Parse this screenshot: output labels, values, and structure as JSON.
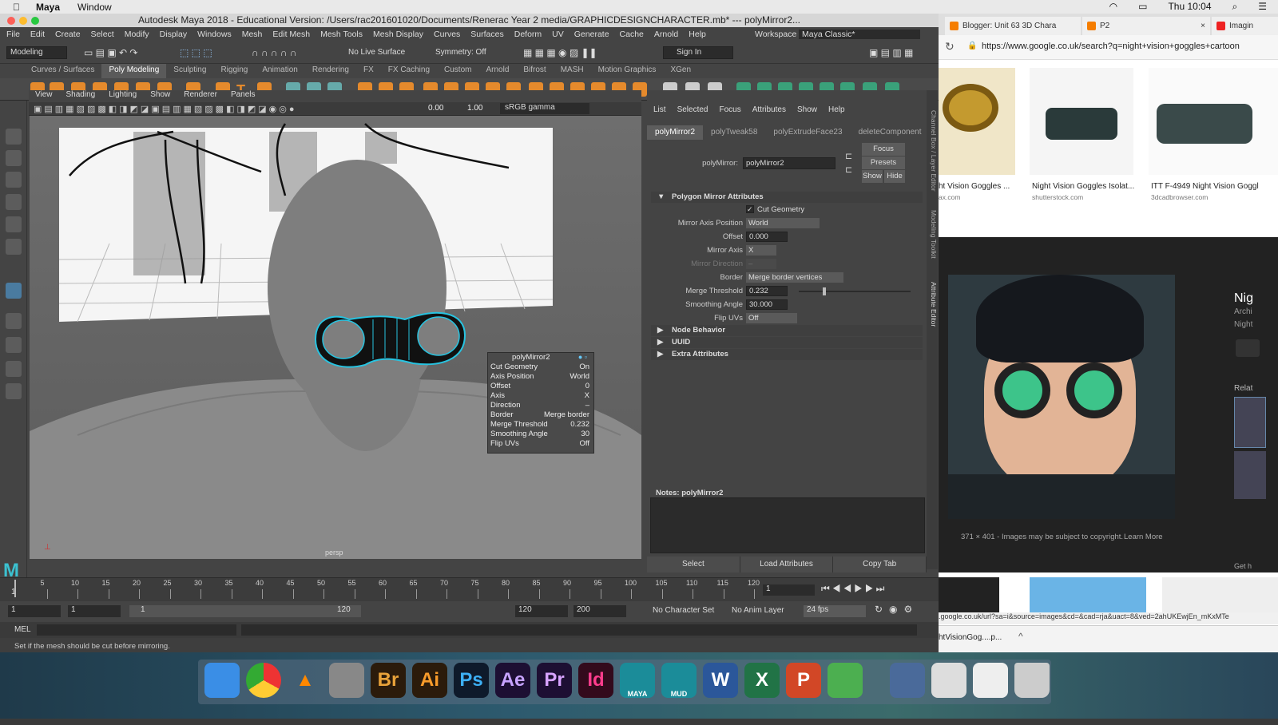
{
  "macos": {
    "app": "Maya",
    "menu": [
      "Window"
    ],
    "clock": "Thu 10:04"
  },
  "maya": {
    "title": "Autodesk Maya 2018 - Educational Version: /Users/rac201601020/Documents/Renerac Year 2 media/GRAPHICDESIGNCHARACTER.mb*  ---  polyMirror2...",
    "menu": [
      "File",
      "Edit",
      "Create",
      "Select",
      "Modify",
      "Display",
      "Windows",
      "Mesh",
      "Edit Mesh",
      "Mesh Tools",
      "Mesh Display",
      "Curves",
      "Surfaces",
      "Deform",
      "UV",
      "Generate",
      "Cache",
      "Arnold",
      "Help"
    ],
    "workspace_label": "Workspace :",
    "workspace": "Maya Classic*",
    "menuset": "Modeling",
    "live_surface": "No Live Surface",
    "symmetry": "Symmetry: Off",
    "sign_in": "Sign In",
    "shelf_tabs": [
      "Curves / Surfaces",
      "Poly Modeling",
      "Sculpting",
      "Rigging",
      "Animation",
      "Rendering",
      "FX",
      "FX Caching",
      "Custom",
      "Arnold",
      "Bifrost",
      "MASH",
      "Motion Graphics",
      "XGen"
    ],
    "active_shelf": "Poly Modeling",
    "viewport_menu": [
      "View",
      "Shading",
      "Lighting",
      "Show",
      "Renderer",
      "Panels"
    ],
    "exposure": "0.00",
    "gamma": "1.00",
    "colorspace": "sRGB gamma",
    "camera": "persp"
  },
  "hud": {
    "title": "polyMirror2",
    "rows": [
      {
        "k": "Cut Geometry",
        "v": "On"
      },
      {
        "k": "Axis Position",
        "v": "World"
      },
      {
        "k": "Offset",
        "v": "0"
      },
      {
        "k": "Axis",
        "v": "X"
      },
      {
        "k": "Direction",
        "v": "–"
      },
      {
        "k": "Border",
        "v": "Merge border"
      },
      {
        "k": "Merge Threshold",
        "v": "0.232"
      },
      {
        "k": "Smoothing Angle",
        "v": "30"
      },
      {
        "k": "Flip UVs",
        "v": "Off"
      }
    ]
  },
  "ae": {
    "menu": [
      "List",
      "Selected",
      "Focus",
      "Attributes",
      "Show",
      "Help"
    ],
    "tabs": [
      "polyMirror2",
      "polyTweak58",
      "polyExtrudeFace23",
      "deleteComponent"
    ],
    "node_label": "polyMirror:",
    "node_value": "polyMirror2",
    "focus": "Focus",
    "presets": "Presets",
    "show": "Show",
    "hide": "Hide",
    "section": "Polygon Mirror Attributes",
    "cut_geometry": "Cut Geometry",
    "mirror_axis_position_label": "Mirror Axis Position",
    "mirror_axis_position": "World",
    "offset_label": "Offset",
    "offset": "0.000",
    "mirror_axis_label": "Mirror Axis",
    "mirror_axis": "X",
    "mirror_direction_label": "Mirror Direction",
    "mirror_direction": "–",
    "border_label": "Border",
    "border": "Merge border vertices",
    "merge_threshold_label": "Merge Threshold",
    "merge_threshold": "0.232",
    "merge_slider": 0.232,
    "smoothing_label": "Smoothing Angle",
    "smoothing": "30.000",
    "flip_label": "Flip UVs",
    "flip": "Off",
    "collapsed": [
      "Node Behavior",
      "UUID",
      "Extra Attributes"
    ],
    "notes": "Notes:  polyMirror2",
    "bottom": [
      "Select",
      "Load Attributes",
      "Copy Tab"
    ],
    "side": [
      "Channel Box / Layer Editor",
      "Modeling Toolkit",
      "Attribute Editor"
    ]
  },
  "timeline": {
    "ticks": [
      "5",
      "10",
      "15",
      "20",
      "25",
      "30",
      "35",
      "40",
      "45",
      "50",
      "55",
      "60",
      "65",
      "70",
      "75",
      "80",
      "85",
      "90",
      "95",
      "100",
      "105",
      "110",
      "115",
      "120"
    ],
    "start_label": "1",
    "current": "1"
  },
  "range": {
    "start": "1",
    "anim_start": "1",
    "slider_start": "1",
    "slider_end": "120",
    "end": "120",
    "anim_end": "200",
    "char_set": "No Character Set",
    "anim_layer": "No Anim Layer",
    "fps": "24 fps"
  },
  "mel": {
    "label": "MEL"
  },
  "help": "Set if the mesh should be cut before mirroring.",
  "chrome": {
    "tabs": [
      "Blogger: Unit 63 3D Chara",
      "P2",
      "Imagin"
    ],
    "url": "https://www.google.co.uk/search?q=night+vision+goggles+cartoon",
    "results": [
      {
        "caption": "ht Vision Goggles ...",
        "source": "ax.com"
      },
      {
        "caption": "Night Vision Goggles Isolat...",
        "source": "shutterstock.com"
      },
      {
        "caption": "ITT F-4949 Night Vision Goggl",
        "source": "3dcadbrowser.com"
      }
    ],
    "panel_title": "Nig",
    "panel_sub1": "Archi",
    "panel_sub2": "Night",
    "related": "Relat",
    "image_info": "371 × 401 - Images may be subject to copyright.",
    "learn_more": "Learn More",
    "get_help": "Get h",
    "status_url": ".google.co.uk/url?sa=i&source=images&cd=&cad=rja&uact=8&ved=2ahUKEwjEn_mKxMTe",
    "download": "htVisionGog....p..."
  },
  "dock": [
    "Br",
    "Ai",
    "Ps",
    "Ae",
    "Pr",
    "Id",
    "MAYA",
    "MUD"
  ]
}
